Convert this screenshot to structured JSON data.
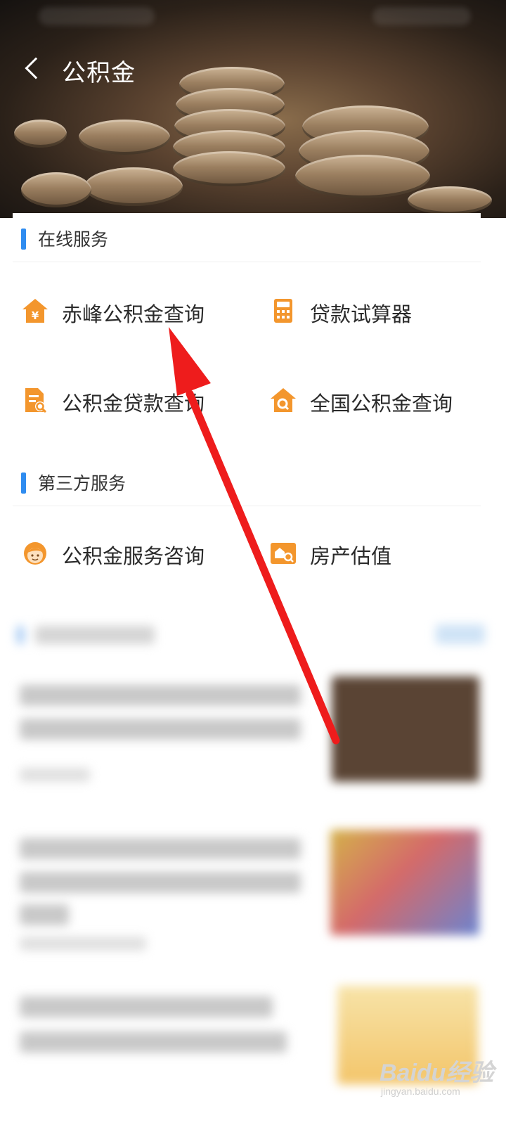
{
  "header": {
    "title": "公积金",
    "back_icon": "chevron-left-icon"
  },
  "sections": [
    {
      "title": "在线服务",
      "items": [
        {
          "label": "赤峰公积金查询",
          "icon": "house-yuan-icon"
        },
        {
          "label": "贷款试算器",
          "icon": "calculator-icon"
        },
        {
          "label": "公积金贷款查询",
          "icon": "document-search-icon"
        },
        {
          "label": "全国公积金查询",
          "icon": "house-search-icon"
        }
      ]
    },
    {
      "title": "第三方服务",
      "items": [
        {
          "label": "公积金服务咨询",
          "icon": "customer-service-icon"
        },
        {
          "label": "房产估值",
          "icon": "property-search-icon"
        }
      ]
    }
  ],
  "colors": {
    "accent_blue": "#2f8cf0",
    "icon_orange": "#f3962d",
    "annotation_red": "#ee1c1c"
  },
  "watermark": {
    "logo": "Baidu经验",
    "sub": "jingyan.baidu.com"
  }
}
